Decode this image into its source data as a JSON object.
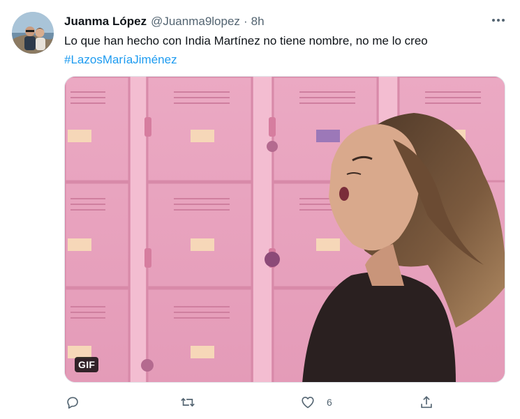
{
  "tweet": {
    "author": {
      "display_name": "Juanma López",
      "handle": "@Juanma9lopez",
      "separator": "·",
      "timestamp": "8h"
    },
    "text": "Lo que han hecho con India Martínez no tiene nombre, no me lo creo",
    "hashtag": "#LazosMaríaJiménez",
    "media": {
      "type": "gif",
      "badge": "GIF"
    },
    "actions": {
      "reply_count": "",
      "retweet_count": "",
      "like_count": "6",
      "share_count": ""
    }
  },
  "icons": {
    "more": "more-horizontal-icon",
    "reply": "reply-icon",
    "retweet": "retweet-icon",
    "like": "heart-icon",
    "share": "share-icon"
  },
  "colors": {
    "text_primary": "#0f1419",
    "text_secondary": "#536471",
    "link": "#1d9bf0",
    "media_background": "#e7a2bd"
  }
}
